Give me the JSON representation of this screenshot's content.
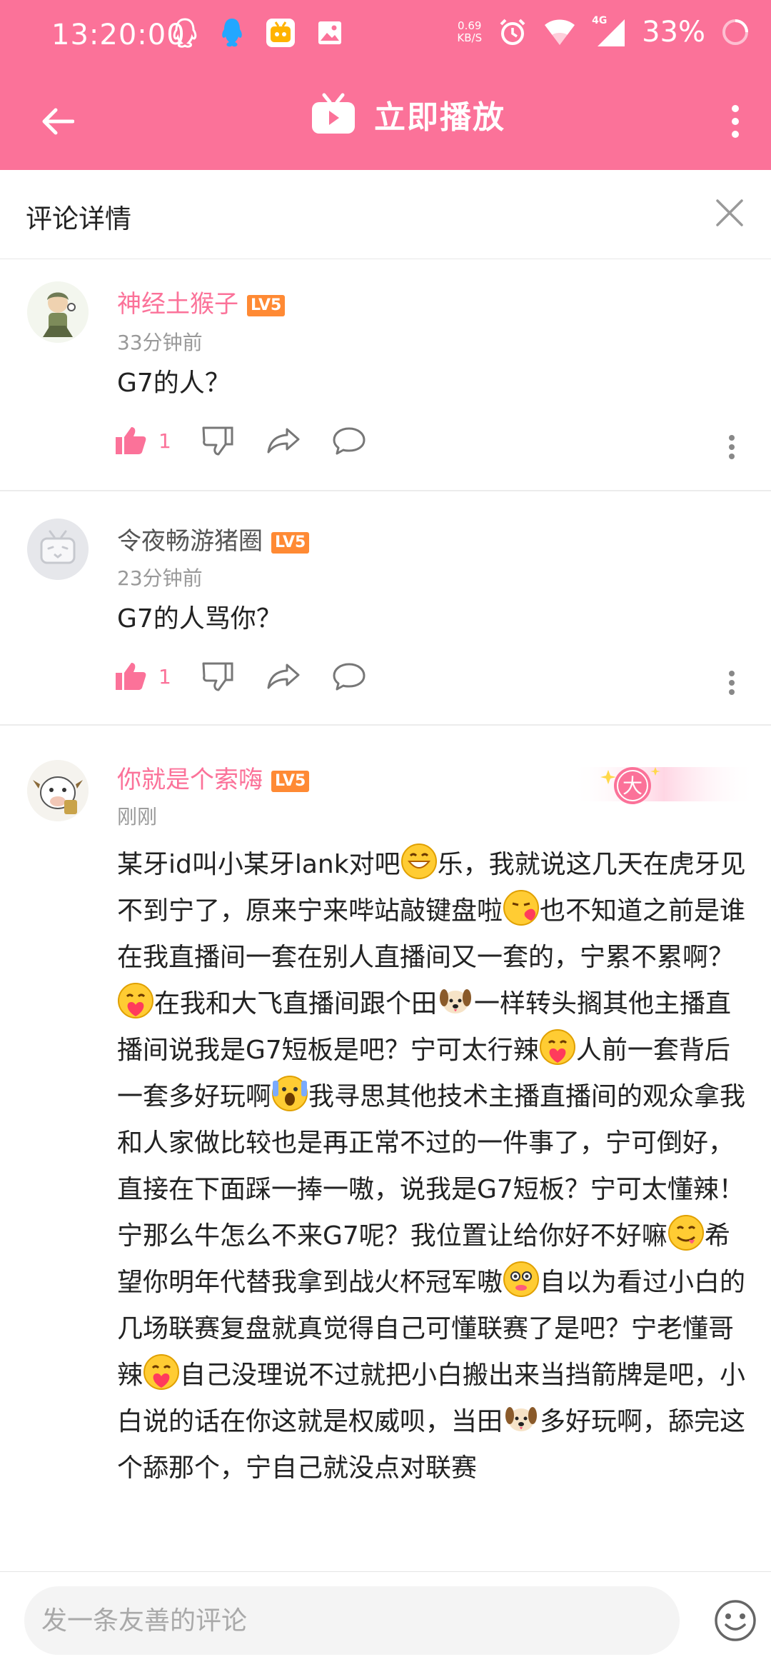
{
  "status_bar": {
    "time": "13:20:00",
    "net_speed_value": "0.69",
    "net_speed_unit": "KB/S",
    "signal_label": "4G",
    "battery": "33%"
  },
  "app_bar": {
    "play_label": "立即播放"
  },
  "detail_header": {
    "title": "评论详情"
  },
  "comments": [
    {
      "username": "神经土猴子",
      "level": "LV5",
      "time": "33分钟前",
      "text": "G7的人？",
      "likes": "1"
    },
    {
      "username": "令夜畅游猪圈",
      "level": "LV5",
      "time": "23分钟前",
      "text": "G7的人骂你？",
      "likes": "1"
    },
    {
      "username": "你就是个索嗨",
      "level": "LV5",
      "time": "刚刚",
      "badge": "大",
      "segments": [
        "某牙id叫小某牙lank对吧",
        "乐，我就说这几天在虎牙见不到宁了，原来宁来哔站敲键盘啦",
        "也不知道之前是谁在我直播间一套在别人直播间又一套的，宁累不累啊？",
        "在我和大飞直播间跟个田",
        "一样转头搁其他主播直播间说我是G7短板是吧？宁可太行辣",
        "人前一套背后一套多好玩啊",
        "我寻思其他技术主播直播间的观众拿我和人家做比较也是再正常不过的一件事了，宁可倒好，直接在下面踩一捧一嗷，说我是G7短板？宁可太懂辣！宁那么牛怎么不来G7呢？我位置让给你好不好嘛",
        "希望你明年代替我拿到战火杯冠军嗷",
        "自以为看过小白的几场联赛复盘就真觉得自己可懂联赛了是吧？宁老懂哥辣",
        "自己没理说不过就把小白搬出来当挡箭牌是吧，小白说的话在你这就是权威呗，当田",
        "多好玩啊，舔完这个舔那个，宁自己就没点对联赛"
      ]
    }
  ],
  "input": {
    "placeholder": "发一条友善的评论"
  },
  "colors": {
    "accent": "#fb7299",
    "level_badge": "#ff8a34"
  },
  "icons": [
    "qq-icon",
    "qq-blue-icon",
    "bilibili-tv-icon",
    "image-icon",
    "alarm-icon",
    "wifi-icon",
    "signal-icon",
    "battery-icon",
    "back-arrow-icon",
    "play-tv-icon",
    "more-vertical-icon",
    "close-icon",
    "thumbs-up-icon",
    "thumbs-down-icon",
    "share-icon",
    "comment-bubble-icon",
    "emoji-face-icon"
  ]
}
